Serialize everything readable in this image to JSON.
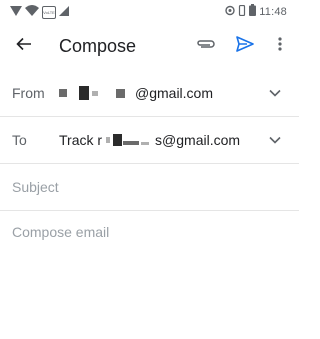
{
  "status_bar": {
    "time": "11:48",
    "icons": [
      "signal-icon",
      "wifi-icon",
      "volte-icon",
      "cellular-icon",
      "location-icon",
      "vibrate-icon",
      "battery-icon"
    ],
    "volte_label": "VoLTE"
  },
  "app_bar": {
    "title": "Compose",
    "back_icon": "back-arrow-icon",
    "attach_icon": "attachment-icon",
    "send_icon": "send-icon",
    "more_icon": "more-vert-icon"
  },
  "from": {
    "label": "From",
    "value_suffix": "@gmail.com"
  },
  "to": {
    "label": "To",
    "prefix": "Track r",
    "suffix": "s@gmail.com"
  },
  "subject": {
    "placeholder": "Subject",
    "value": ""
  },
  "body": {
    "placeholder": "Compose email",
    "value": ""
  },
  "colors": {
    "accent": "#1a73e8",
    "text": "#202124",
    "secondary_text": "#5f6368",
    "placeholder": "#9aa0a6",
    "divider": "#e5e5e5"
  }
}
